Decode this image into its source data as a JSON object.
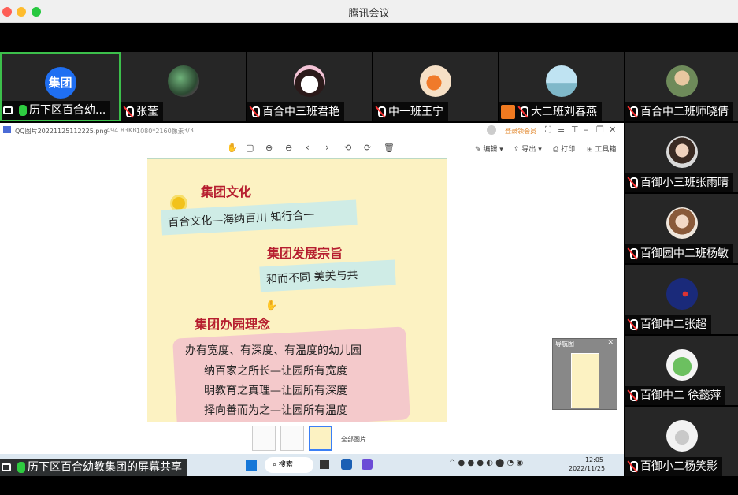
{
  "window": {
    "title": "腾讯会议"
  },
  "top_participants": [
    {
      "avatar_text": "集团",
      "name": "历下区百合幼...",
      "mic": "on",
      "sharing": true,
      "active": true
    },
    {
      "avatar_text": "",
      "name": "张莹",
      "mic": "muted"
    },
    {
      "avatar_text": "",
      "name": "百合中三班君艳",
      "mic": "muted"
    },
    {
      "avatar_text": "",
      "name": "中一班王宁",
      "mic": "muted"
    },
    {
      "avatar_text": "",
      "name": "大二班刘春燕",
      "mic": "muted",
      "person_icon": true
    },
    {
      "avatar_text": "",
      "name": "百合中二班师晓倩",
      "mic": "muted"
    }
  ],
  "side_participants": [
    {
      "name": "百御小三班张雨晴",
      "mic": "muted"
    },
    {
      "name": "百御园中二班杨敏",
      "mic": "muted"
    },
    {
      "name": "百御中二张超",
      "mic": "muted"
    },
    {
      "name": "百御中二 徐懿萍",
      "mic": "muted"
    },
    {
      "name": "百御小二杨笑影",
      "mic": "muted"
    }
  ],
  "viewer": {
    "filename": "QQ图片20221125112225.png",
    "filesize": "494.83KB",
    "dimensions": "1080*2160像素",
    "index": "3/3",
    "login_vip": "登录领会员",
    "edit_label": "编辑",
    "export_label": "导出",
    "print_label": "打印",
    "toolbox_label": "工具箱",
    "all_images_label": "全部图片",
    "navigator_title": "导航图"
  },
  "poster": {
    "heading_culture": "集团文化",
    "culture_text": "百合文化—海纳百川  知行合一",
    "heading_purpose": "集团发展宗旨",
    "purpose_text": "和而不同  美美与共",
    "heading_philosophy": "集团办园理念",
    "lines": [
      "办有宽度、有深度、有温度的幼儿园",
      "纳百家之所长—让园所有宽度",
      "明教育之真理—让园所有深度",
      "择向善而为之—让园所有温度"
    ]
  },
  "taskbar": {
    "search_label": "搜索",
    "time": "12:05",
    "date": "2022/11/25"
  },
  "share_caption": "历下区百合幼教集团的屏幕共享",
  "colors": {
    "active_border": "#3cbf4b",
    "avatar_blue": "#1f6ff2",
    "poster_bg": "#fcf2c2",
    "poster_red": "#b61e2f"
  }
}
